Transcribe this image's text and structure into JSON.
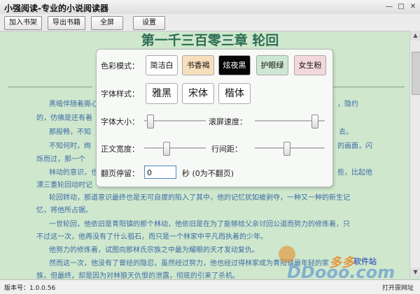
{
  "window": {
    "title": "小强阅读-专业的小说阅读器",
    "min": "—",
    "max": "□",
    "close": "✕"
  },
  "toolbar": {
    "add": "加入书架",
    "export": "导出书籍",
    "fullscreen": "全屏",
    "settings": "设置"
  },
  "chapter_title": "第一千三百零三章  轮回",
  "content": [
    "黑暗伴随着撕心",
    "的，仿佛是还有着",
    "那般畅，不知",
    "不知何时，绚",
    "烁而过，那一个",
    "林动的意识，也",
    "漂三重轮回动时记",
    "轮回转动，那道意识最终也是无可自拔的陷入了其中，他的记忆犹如被剥夺，一种又一种的新生记",
    "忆，将他所占据。",
    "一世轮回，他依旧是青阳镇的那个林动，他依旧是在为了能够给父亲讨回公道而努力的修炼着，只",
    "不过这一次，他再没有了什么祖石，而只是一个林家中平凡而执着的少年。",
    "他努力的修炼着，试图向那林氏宗族之中最为耀眼的天才发动复仇。",
    "然而这一次，他没有了曾经的隐忍，虽然经过努力，他也经过得林家成为青阳镇最年轻的家",
    "族，但最终，却是因为对林狼天仇恨的泄露，彻底的引来了杀机。"
  ],
  "content_right": [
    "，隐约",
    "去。",
    "的画面，闪",
    "些，比起他"
  ],
  "panel": {
    "color_label": "色彩模式：",
    "colors": [
      {
        "label": "简洁白",
        "bg": "#ffffff",
        "fg": "#111111"
      },
      {
        "label": "书香褐",
        "bg": "#f7dfbd",
        "fg": "#111111"
      },
      {
        "label": "炫夜黑",
        "bg": "#050505",
        "fg": "#ffffff"
      },
      {
        "label": "护眼绿",
        "bg": "#cde7d3",
        "fg": "#111111"
      },
      {
        "label": "女生粉",
        "bg": "#f2d7dc",
        "fg": "#111111"
      }
    ],
    "font_style_label": "字体样式：",
    "fonts": [
      "雅黑",
      "宋体",
      "楷体"
    ],
    "font_size_label": "字体大小：",
    "scroll_speed_label": "滚屏速度：",
    "width_label": "正文宽度：",
    "line_spacing_label": "行间距：",
    "page_delay_label": "翻页停留：",
    "page_delay_value": "0",
    "page_delay_unit": "秒 (0为不翻页)",
    "font_size_level": 0.05,
    "scroll_speed_level": 0.9,
    "width_level": 0.35,
    "line_spacing_level": 0.45
  },
  "status": {
    "version": "版本号：1.0.0.56",
    "open_url": "打开原网址"
  },
  "watermark": {
    "brand": "多多",
    "sub": "软件站",
    "domain": "DDooo.com"
  },
  "colors": {
    "background": "#cfe8cd",
    "title_color": "#2e6e56",
    "text_color": "#3e6aa5"
  }
}
